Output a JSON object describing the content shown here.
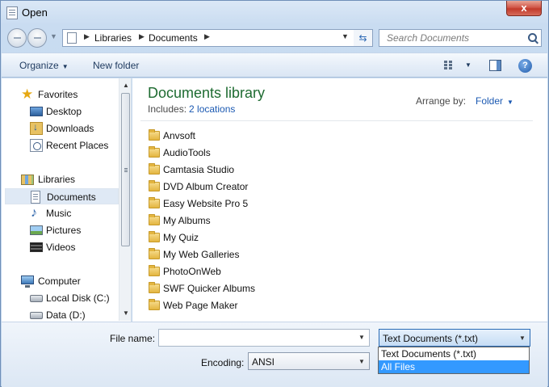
{
  "window": {
    "title": "Open",
    "close_label": "x"
  },
  "address": {
    "parts": [
      "Libraries",
      "Documents"
    ]
  },
  "search": {
    "placeholder": "Search Documents"
  },
  "toolbar": {
    "organize_label": "Organize",
    "new_folder_label": "New folder",
    "help_label": "?"
  },
  "nav": {
    "favorites": [
      "Favorites",
      "Desktop",
      "Downloads",
      "Recent Places"
    ],
    "libraries": [
      "Libraries",
      "Documents",
      "Music",
      "Pictures",
      "Videos"
    ],
    "computer": [
      "Computer",
      "Local Disk (C:)",
      "Data (D:)"
    ],
    "selected": "Documents"
  },
  "content": {
    "title": "Documents library",
    "includes_label": "Includes:",
    "includes_link": "2 locations",
    "arrange_label": "Arrange by:",
    "arrange_value": "Folder",
    "folders": [
      "Anvsoft",
      "AudioTools",
      "Camtasia Studio",
      "DVD Album Creator",
      "Easy Website Pro 5",
      "My Albums",
      "My Quiz",
      "My Web Galleries",
      "PhotoOnWeb",
      "SWF Quicker Albums",
      "Web Page Maker"
    ]
  },
  "footer": {
    "file_name_label": "File name:",
    "file_name_value": "",
    "encoding_label": "Encoding:",
    "encoding_value": "ANSI",
    "file_type_value": "Text Documents (*.txt)",
    "file_type_options": [
      "Text Documents (*.txt)",
      "All Files"
    ],
    "hovered_option": "All Files"
  }
}
